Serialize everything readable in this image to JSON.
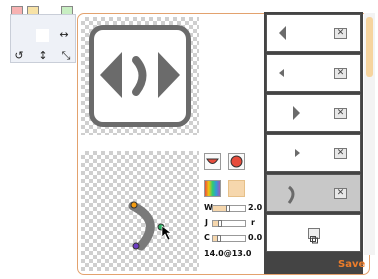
{
  "toolbar": {
    "icons": [
      "chevron-down-icon",
      "chevron-down-icon",
      "copy-icon"
    ]
  },
  "transform_panel": {
    "icons": [
      "flip-horizontal-icon",
      "rotate-icon",
      "flip-vertical-icon",
      "resize-icon"
    ]
  },
  "preview": {
    "frame_color": "#6b6b6b"
  },
  "editor": {
    "width_label": "W",
    "width_value": "2.0",
    "width_level": 0.45,
    "join_label": "J",
    "join_value": "r",
    "join_level": 0.2,
    "cap_label": "C",
    "cap_value": "0.0",
    "cap_level": 0.15,
    "status": "14.0@13.0"
  },
  "layers": {
    "items": [
      {
        "shape": "left-triangle-large",
        "selected": false
      },
      {
        "shape": "left-triangle-small",
        "selected": false
      },
      {
        "shape": "right-triangle-large",
        "selected": false
      },
      {
        "shape": "right-triangle-small",
        "selected": false
      },
      {
        "shape": "curve",
        "selected": true
      }
    ]
  },
  "colors": {
    "accent": "#ee7d2a",
    "panel_border": "#e3a26e",
    "shape": "#6b6b6b"
  },
  "save_label": "Save"
}
